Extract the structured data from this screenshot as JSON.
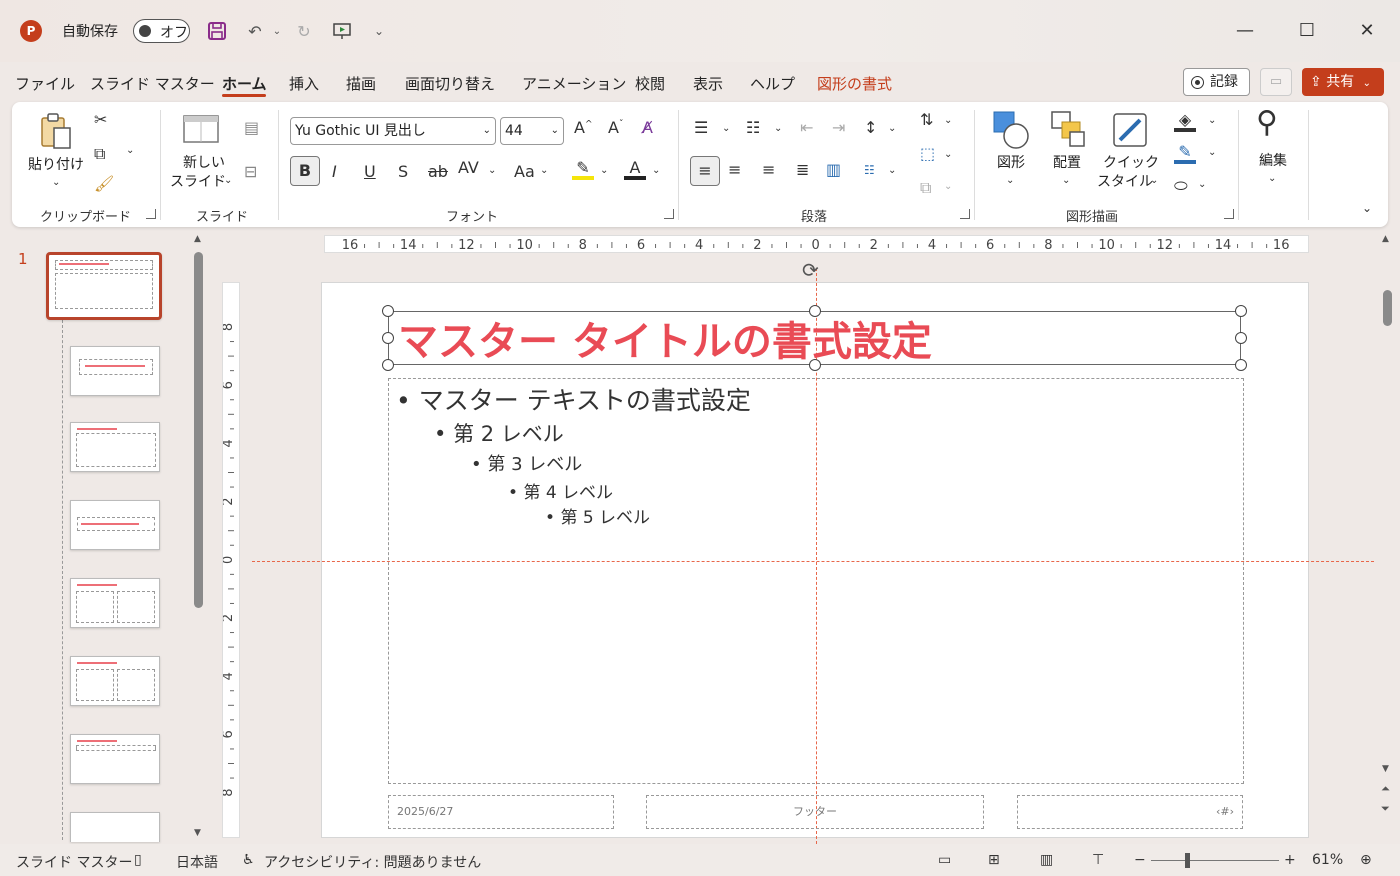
{
  "titlebar": {
    "autosave_label": "自動保存",
    "autosave_state": "オフ"
  },
  "menu": {
    "tabs": [
      "ファイル",
      "スライド マスター",
      "ホーム",
      "挿入",
      "描画",
      "画面切り替え",
      "アニメーション",
      "校閲",
      "表示",
      "ヘルプ",
      "図形の書式"
    ],
    "active_tab": "ホーム",
    "record_label": "記録",
    "share_label": "共有"
  },
  "ribbon": {
    "clipboard": {
      "paste_label": "貼り付け",
      "group_label": "クリップボード"
    },
    "slides": {
      "new_slide_label_1": "新しい",
      "new_slide_label_2": "スライド",
      "group_label": "スライド"
    },
    "font": {
      "font_name": "Yu Gothic UI 見出し",
      "font_size": "44",
      "group_label": "フォント"
    },
    "paragraph": {
      "group_label": "段落"
    },
    "drawing": {
      "shape_label": "図形",
      "arrange_label": "配置",
      "quick_style_label_1": "クイック",
      "quick_style_label_2": "スタイル",
      "group_label": "図形描画"
    },
    "editing": {
      "edit_label": "編集"
    }
  },
  "thumbnails": {
    "selected_number": "1"
  },
  "ruler": {
    "top_ticks": [
      "16",
      "14",
      "12",
      "10",
      "8",
      "6",
      "4",
      "2",
      "0",
      "2",
      "4",
      "6",
      "8",
      "10",
      "12",
      "14",
      "16"
    ],
    "left_ticks": [
      "8",
      "6",
      "4",
      "2",
      "0",
      "2",
      "4",
      "6",
      "8"
    ]
  },
  "slide": {
    "title": "マスター タイトルの書式設定",
    "level1": "マスター テキストの書式設定",
    "level2": "第 2 レベル",
    "level3": "第 3 レベル",
    "level4": "第 4 レベル",
    "level5": "第 5 レベル",
    "date": "2025/6/27",
    "footer": "フッター",
    "slide_number": "‹#›"
  },
  "colors": {
    "accent": "#c43e1c",
    "title_red": "#e94b55"
  },
  "status": {
    "view": "スライド マスター",
    "language": "日本語",
    "accessibility": "アクセシビリティ: 問題ありません",
    "zoom": "61%"
  }
}
